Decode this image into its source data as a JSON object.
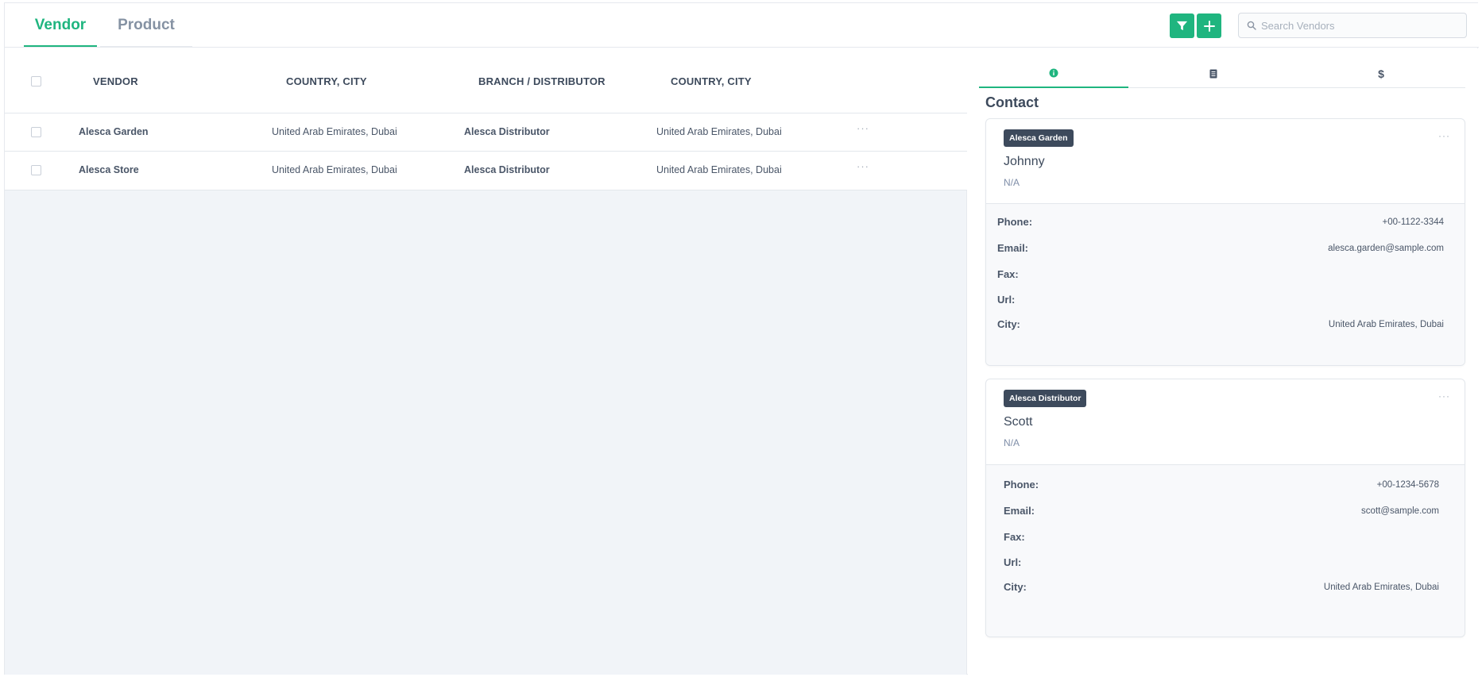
{
  "tabs": {
    "vendor": "Vendor",
    "product": "Product"
  },
  "search": {
    "placeholder": "Search Vendors"
  },
  "table": {
    "columns": [
      "VENDOR",
      "COUNTRY, CITY",
      "BRANCH / DISTRIBUTOR",
      "COUNTRY, CITY"
    ],
    "rows": [
      {
        "vendor": "Alesca Garden",
        "vendor_location": "United Arab Emirates, Dubai",
        "branch": "Alesca Distributor",
        "branch_location": "United Arab Emirates, Dubai",
        "more": "···"
      },
      {
        "vendor": "Alesca Store",
        "vendor_location": "United Arab Emirates, Dubai",
        "branch": "Alesca Distributor",
        "branch_location": "United Arab Emirates, Dubai",
        "more": "···"
      }
    ]
  },
  "panel": {
    "tabs": {
      "info_icon": "info-icon",
      "doc_icon": "document-icon",
      "money": "$"
    },
    "title": "Contact",
    "contacts": [
      {
        "badge": "Alesca Garden",
        "name": "Johnny",
        "role": "N/A",
        "more": "···",
        "fields": [
          {
            "label": "Phone:",
            "value": "+00-1122-3344"
          },
          {
            "label": "Email:",
            "value": "alesca.garden@sample.com"
          },
          {
            "label": "Fax:",
            "value": ""
          },
          {
            "label": "Url:",
            "value": ""
          },
          {
            "label": "City:",
            "value": "United Arab Emirates, Dubai"
          }
        ]
      },
      {
        "badge": "Alesca Distributor",
        "name": "Scott",
        "role": "N/A",
        "more": "···",
        "fields": [
          {
            "label": "Phone:",
            "value": "+00-1234-5678"
          },
          {
            "label": "Email:",
            "value": "scott@sample.com"
          },
          {
            "label": "Fax:",
            "value": ""
          },
          {
            "label": "Url:",
            "value": ""
          },
          {
            "label": "City:",
            "value": "United Arab Emirates, Dubai"
          }
        ]
      }
    ]
  },
  "colors": {
    "accent": "#1fb57f",
    "text": "#3d4a5c",
    "badge_bg": "#3d4a5c",
    "muted": "#7f8ea8",
    "pane_bg": "#f1f4f8"
  }
}
